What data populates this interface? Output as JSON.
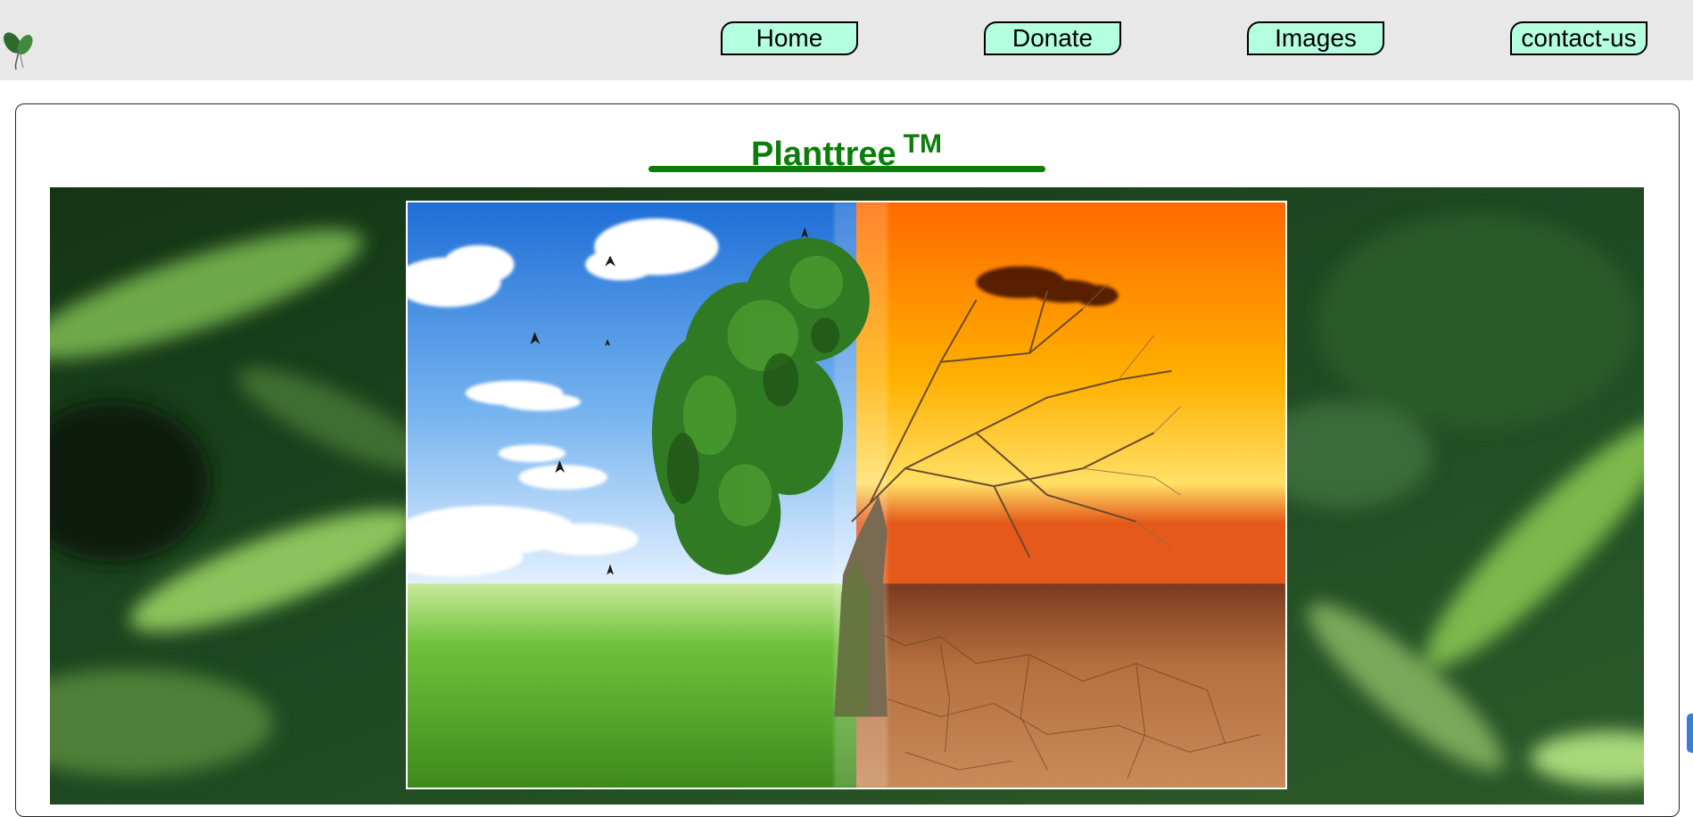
{
  "nav": {
    "home": "Home",
    "donate": "Donate",
    "images": "Images",
    "contact": "contact-us"
  },
  "header": {
    "title": "Planttree",
    "trademark": "TM"
  },
  "colors": {
    "brand_green": "#0b7d0b",
    "nav_button_bg": "#b3ffe0",
    "topbar_bg": "#e8e8e8"
  },
  "hero": {
    "background_alt": "blurred green leaves",
    "photo_alt": "tree half green with blue sky, half bare with orange sunset and cracked earth"
  }
}
